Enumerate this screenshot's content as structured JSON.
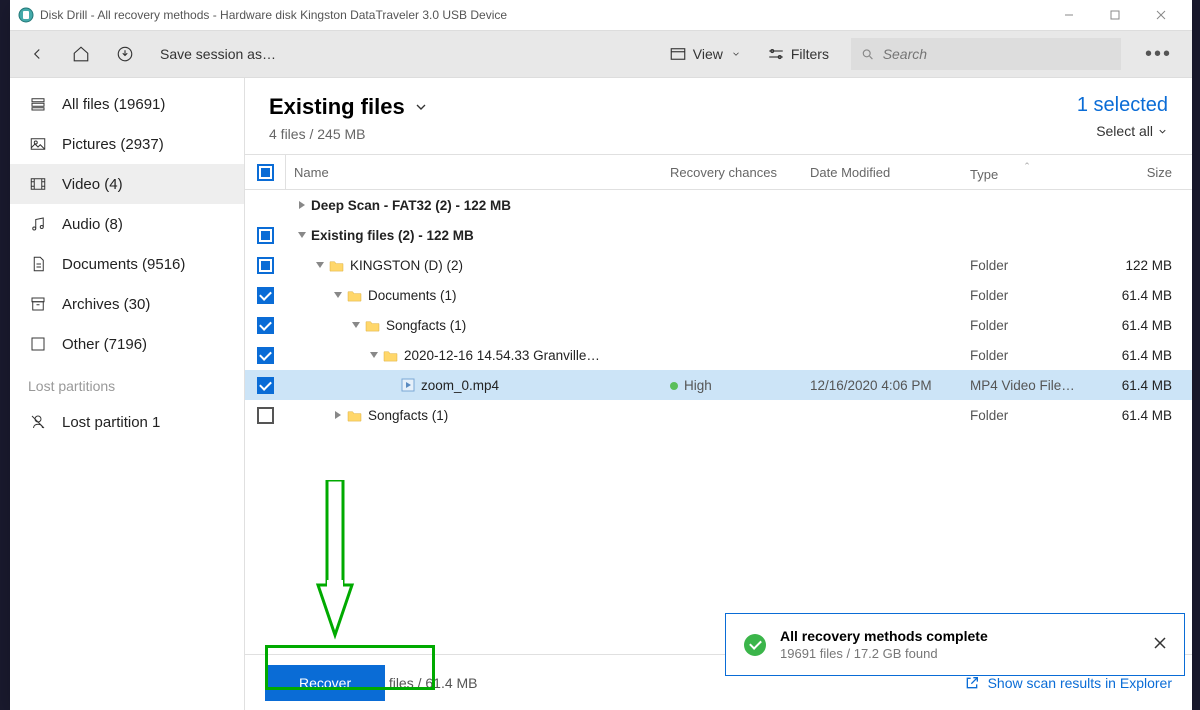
{
  "window": {
    "title": "Disk Drill - All recovery methods - Hardware disk Kingston DataTraveler 3.0 USB Device"
  },
  "toolbar": {
    "save_session": "Save session as…",
    "view": "View",
    "filters": "Filters",
    "search_placeholder": "Search"
  },
  "sidebar": {
    "items": [
      {
        "label": "All files (19691)"
      },
      {
        "label": "Pictures (2937)"
      },
      {
        "label": "Video (4)"
      },
      {
        "label": "Audio (8)"
      },
      {
        "label": "Documents (9516)"
      },
      {
        "label": "Archives (30)"
      },
      {
        "label": "Other (7196)"
      }
    ],
    "lost_header": "Lost partitions",
    "lost_item": "Lost partition 1"
  },
  "mainhead": {
    "title": "Existing files",
    "subtitle": "4 files / 245 MB",
    "selected": "1 selected",
    "select_all": "Select all"
  },
  "columns": {
    "name": "Name",
    "recovery": "Recovery chances",
    "date": "Date Modified",
    "type": "Type",
    "size": "Size"
  },
  "rows": [
    {
      "check": "none",
      "depth": 0,
      "twisty": "right",
      "bold": true,
      "name": "Deep Scan - FAT32 (2) - 122 MB",
      "type": "",
      "size": "",
      "date": "",
      "rec": ""
    },
    {
      "check": "mixed",
      "depth": 0,
      "twisty": "down",
      "bold": true,
      "name": "Existing files (2) - 122 MB",
      "type": "",
      "size": "",
      "date": "",
      "rec": ""
    },
    {
      "check": "mixed",
      "depth": 1,
      "twisty": "down",
      "icon": "folder",
      "name": "KINGSTON (D) (2)",
      "type": "Folder",
      "size": "122 MB",
      "date": "",
      "rec": ""
    },
    {
      "check": "checked",
      "depth": 2,
      "twisty": "down",
      "icon": "folder",
      "name": "Documents (1)",
      "type": "Folder",
      "size": "61.4 MB",
      "date": "",
      "rec": ""
    },
    {
      "check": "checked",
      "depth": 3,
      "twisty": "down",
      "icon": "folder",
      "name": "Songfacts (1)",
      "type": "Folder",
      "size": "61.4 MB",
      "date": "",
      "rec": ""
    },
    {
      "check": "checked",
      "depth": 4,
      "twisty": "down",
      "icon": "folder",
      "name": "2020-12-16 14.54.33 Granville…",
      "type": "Folder",
      "size": "61.4 MB",
      "date": "",
      "rec": ""
    },
    {
      "check": "checked",
      "depth": 5,
      "twisty": "none",
      "icon": "file",
      "name": "zoom_0.mp4",
      "type": "MP4 Video File…",
      "size": "61.4 MB",
      "date": "12/16/2020 4:06 PM",
      "rec": "High",
      "sel": true
    },
    {
      "check": "empty",
      "depth": 2,
      "twisty": "right",
      "icon": "folder",
      "name": "Songfacts (1)",
      "type": "Folder",
      "size": "61.4 MB",
      "date": "",
      "rec": ""
    }
  ],
  "footer": {
    "recover": "Recover",
    "info": "1 files / 61.4 MB",
    "explorer": "Show scan results in Explorer"
  },
  "toast": {
    "title": "All recovery methods complete",
    "sub": "19691 files / 17.2 GB found"
  }
}
